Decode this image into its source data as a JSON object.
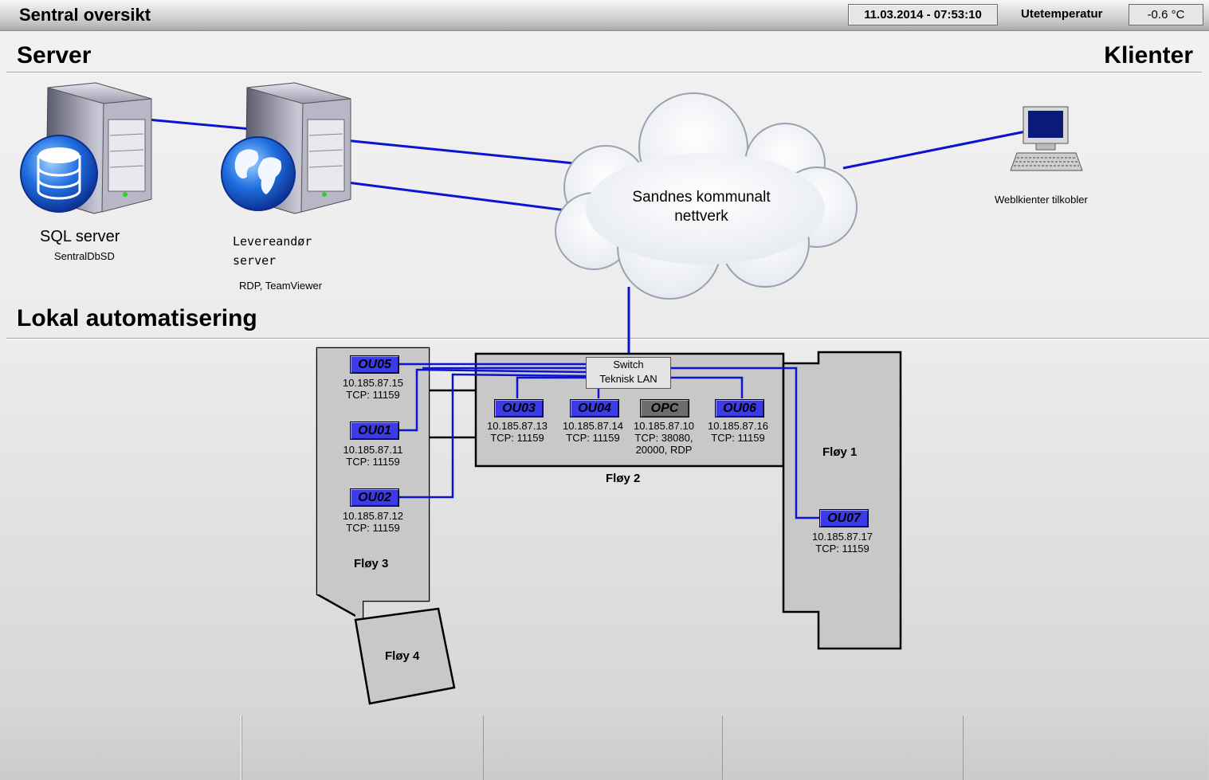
{
  "header": {
    "title": "Sentral oversikt",
    "datetime": "11.03.2014 - 07:53:10",
    "temp_label": "Utetemperatur",
    "temp_value": "-0.6 °C"
  },
  "sections": {
    "server": "Server",
    "clients": "Klienter",
    "local": "Lokal automatisering"
  },
  "servers": {
    "sql_title": "SQL server",
    "sql_subtitle": "SentralDbSD",
    "vendor_title_line1": "Levereandør",
    "vendor_title_line2": "server",
    "vendor_subtitle": "RDP, TeamViewer"
  },
  "network": {
    "cloud_line1": "Sandnes kommunalt",
    "cloud_line2": "nettverk",
    "client_label": "Weblkienter tilkobler",
    "switch_line1": "Switch",
    "switch_line2": "Teknisk LAN"
  },
  "units": {
    "ou05": {
      "label": "OU05",
      "ip": "10.185.87.15",
      "tcp": "TCP: 11159"
    },
    "ou01": {
      "label": "OU01",
      "ip": "10.185.87.11",
      "tcp": "TCP: 11159"
    },
    "ou02": {
      "label": "OU02",
      "ip": "10.185.87.12",
      "tcp": "TCP: 11159"
    },
    "ou03": {
      "label": "OU03",
      "ip": "10.185.87.13",
      "tcp": "TCP: 11159"
    },
    "ou04": {
      "label": "OU04",
      "ip": "10.185.87.14",
      "tcp": "TCP: 11159"
    },
    "opc": {
      "label": "OPC",
      "ip": "10.185.87.10",
      "tcp": "TCP: 38080,",
      "tcp2": "20000, RDP"
    },
    "ou06": {
      "label": "OU06",
      "ip": "10.185.87.16",
      "tcp": "TCP: 11159"
    },
    "ou07": {
      "label": "OU07",
      "ip": "10.185.87.17",
      "tcp": "TCP: 11159"
    }
  },
  "floors": {
    "floy1": "Fløy 1",
    "floy2": "Fløy 2",
    "floy3": "Fløy 3",
    "floy4": "Fløy 4"
  },
  "colors": {
    "link": "#0a14d2",
    "unit_blue": "#3b3bea",
    "opc_gray": "#6d6d6d",
    "floor_fill": "#c8c8c8"
  },
  "icons": [
    "database-server-icon",
    "web-server-icon",
    "cloud-icon",
    "computer-icon"
  ]
}
